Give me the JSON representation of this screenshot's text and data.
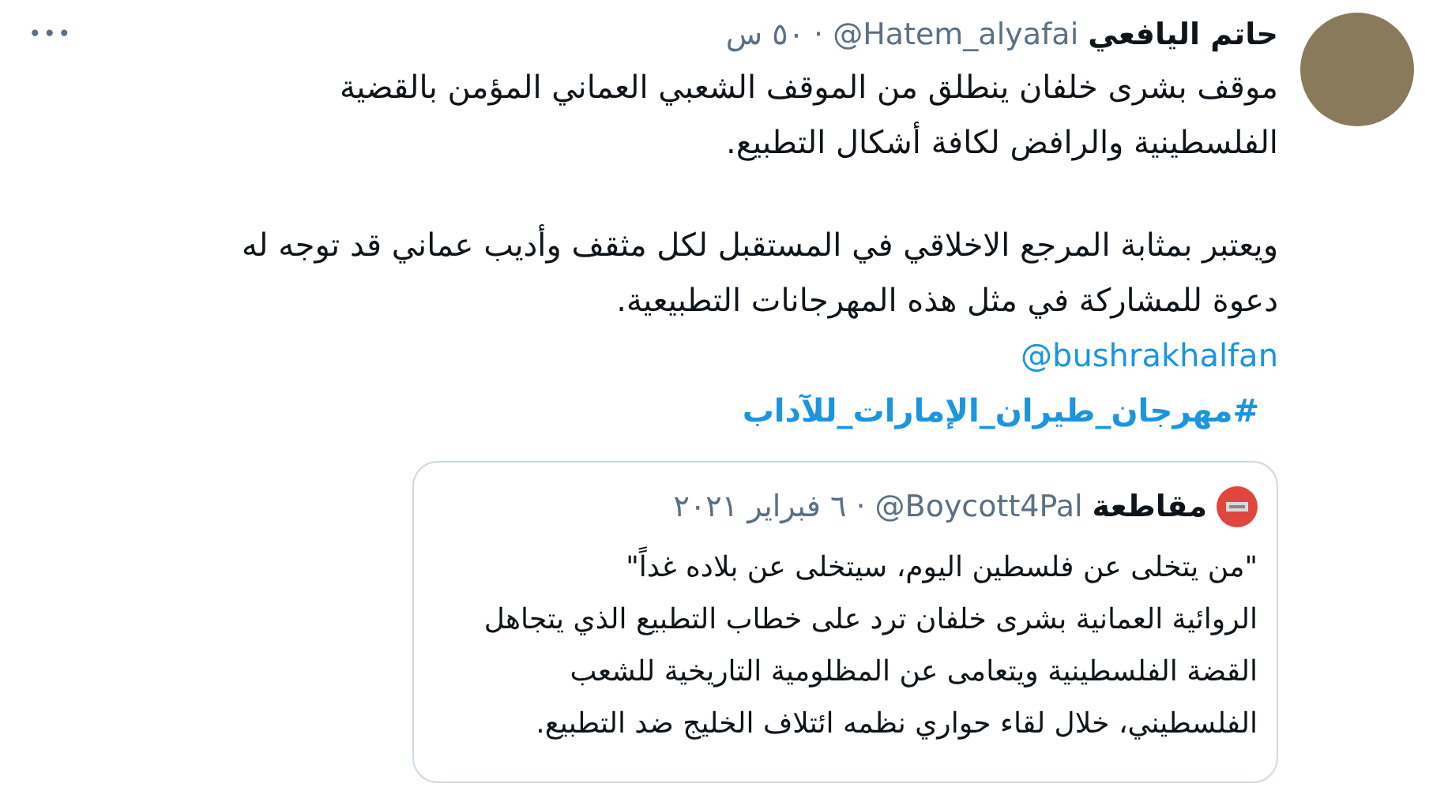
{
  "tweet": {
    "author_name": "حاتم اليافعي",
    "handle": "@Hatem_alyafai",
    "separator": "·",
    "time": "٥٠ س",
    "more": "•••",
    "paragraphs": [
      "موقف بشرى خلفان ينطلق من الموقف الشعبي العماني المؤمن بالقضية الفلسطينية والرافض لكافة أشكال التطبيع.",
      "ويعتبر بمثابة المرجع الاخلاقي في المستقبل لكل مثقف وأديب عماني قد توجه له دعوة للمشاركة في مثل هذه المهرجانات التطبيعية."
    ],
    "mention": "@bushrakhalfan",
    "hashtag": "#مهرجان_طيران_الإمارات_للآداب"
  },
  "quoted_tweet": {
    "author_name": "مقاطعة",
    "handle": "@Boycott4Pal",
    "separator": "·",
    "date": "٦ فبراير ٢٠٢١",
    "paragraphs": [
      "\"من يتخلى عن فلسطين اليوم، سيتخلى عن بلاده غداً\"",
      "الروائية العمانية بشرى خلفان ترد على خطاب التطبيع الذي يتجاهل القضة الفلسطينية ويتعامى عن المظلومية التاريخية للشعب الفلسطيني، خلال لقاء حواري نظمه ائتلاف الخليج ضد التطبيع."
    ]
  }
}
